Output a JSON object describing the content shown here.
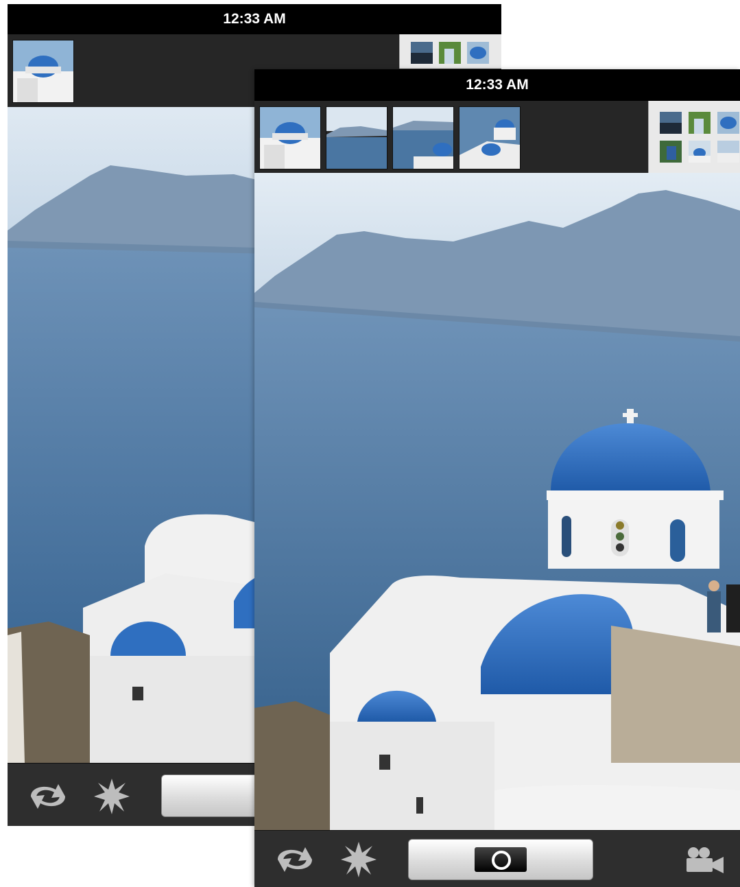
{
  "screens": {
    "back": {
      "status_time": "12:33 AM",
      "thumbnails": [
        "thumb-1"
      ],
      "toolbar": {
        "switch_camera_icon": "rotate-arrows-icon",
        "flash_icon": "starburst-icon",
        "shutter_icon": "camera-lens-icon"
      }
    },
    "front": {
      "status_time": "12:33 AM",
      "thumbnails": [
        "thumb-1",
        "thumb-2",
        "thumb-3",
        "thumb-4"
      ],
      "toolbar": {
        "switch_camera_icon": "rotate-arrows-icon",
        "flash_icon": "starburst-icon",
        "shutter_icon": "camera-lens-icon",
        "video_icon": "video-camera-icon"
      }
    }
  },
  "colors": {
    "status_bar": "#000000",
    "thumbnail_strip": "#262626",
    "toolbar": "#2e2e2e",
    "gallery_button": "#e9e9e9",
    "dome_blue": "#2f6fc0",
    "sea_blue": "#2e5a86"
  }
}
